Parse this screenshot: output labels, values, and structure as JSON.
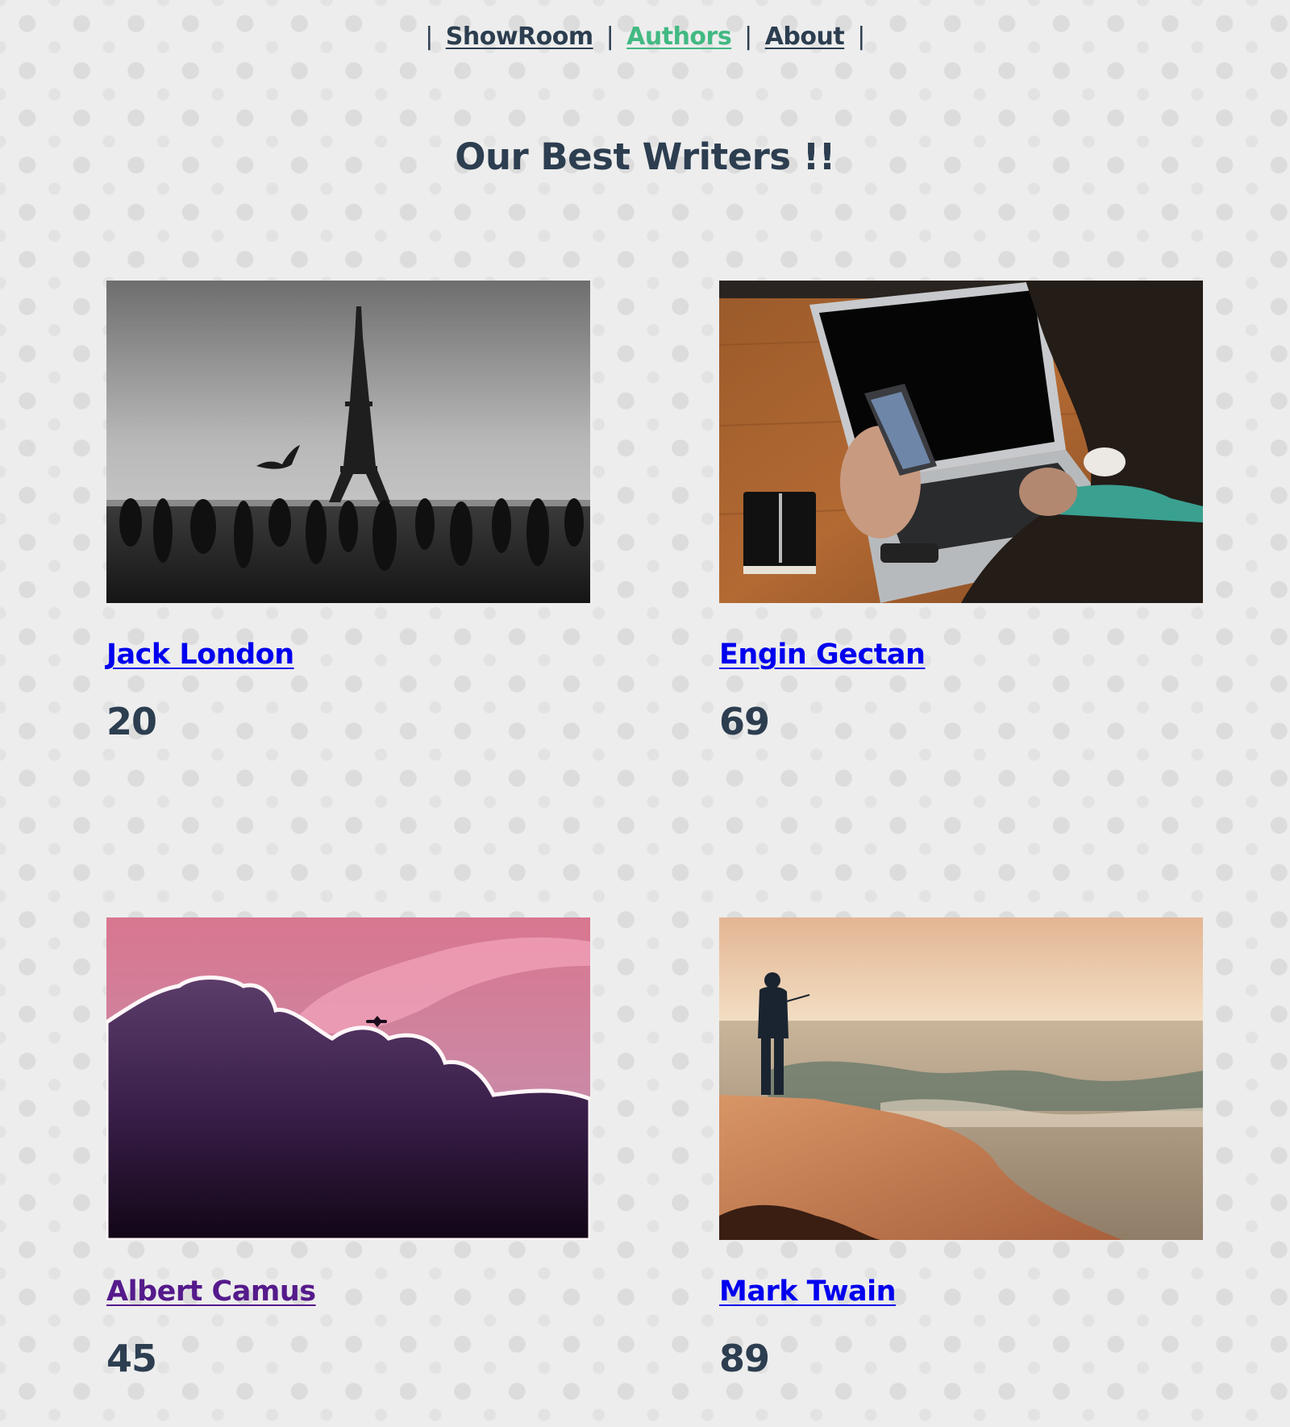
{
  "nav": {
    "separator": "|",
    "items": [
      {
        "label": "ShowRoom"
      },
      {
        "label": "Authors",
        "active": true
      },
      {
        "label": "About"
      }
    ]
  },
  "page": {
    "title": "Our Best Writers !!"
  },
  "authors": [
    {
      "name": "Jack London",
      "count": "20",
      "image": "eiffel-tower-bw-photo"
    },
    {
      "name": "Engin Gectan",
      "count": "69",
      "image": "laptop-phone-photo"
    },
    {
      "name": "Albert Camus",
      "count": "45",
      "image": "clouds-airplane-photo"
    },
    {
      "name": "Mark Twain",
      "count": "89",
      "image": "fisherman-sea-photo"
    }
  ],
  "colors": {
    "text": "#2c3e50",
    "active_nav": "#42b983",
    "link": "#0000ee",
    "visited_link": "#551a8b",
    "background": "#ededed"
  }
}
